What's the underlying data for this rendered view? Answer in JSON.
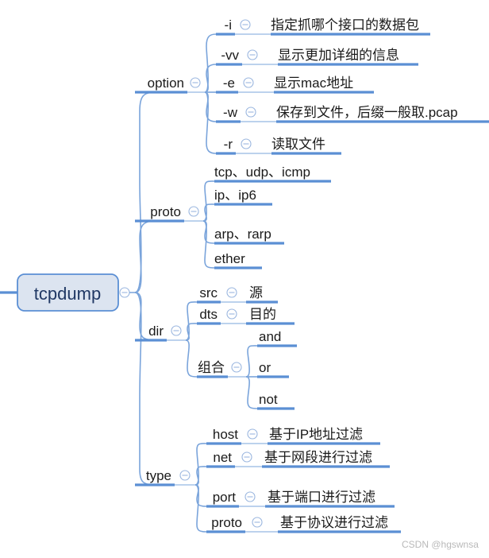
{
  "diagram": {
    "type": "mind-map",
    "title": "tcpdump",
    "root": {
      "label": "tcpdump",
      "toggle": "collapse-toggle-icon"
    },
    "watermark": "CSDN @hgswnsa",
    "colors": {
      "bar": "#5b8fd4",
      "branch": "#7aa4db",
      "root_fill": "#dce4f0",
      "root_border": "#5b8fd4",
      "root_text": "#203864",
      "node_text": "#1a1a1a",
      "toggle": "#9ab6df",
      "watermark": "#b9b9b9",
      "background": "#ffffff"
    },
    "branches": [
      {
        "label": "option",
        "children": [
          {
            "label": "-i",
            "desc": "指定抓哪个接口的数据包"
          },
          {
            "label": "-vv",
            "desc": "显示更加详细的信息"
          },
          {
            "label": "-e",
            "desc": "显示mac地址"
          },
          {
            "label": "-w",
            "desc": "保存到文件，后缀一般取.pcap"
          },
          {
            "label": "-r",
            "desc": "读取文件"
          }
        ]
      },
      {
        "label": "proto",
        "children": [
          {
            "label": "tcp、udp、icmp",
            "desc": ""
          },
          {
            "label": "ip、ip6",
            "desc": ""
          },
          {
            "label": "arp、rarp",
            "desc": ""
          },
          {
            "label": "ether",
            "desc": ""
          }
        ]
      },
      {
        "label": "dir",
        "children": [
          {
            "label": "src",
            "desc": "源"
          },
          {
            "label": "dts",
            "desc": "目的"
          },
          {
            "label": "组合",
            "desc": "",
            "children": [
              {
                "label": "and",
                "desc": ""
              },
              {
                "label": "or",
                "desc": ""
              },
              {
                "label": "not",
                "desc": ""
              }
            ]
          }
        ]
      },
      {
        "label": "type",
        "children": [
          {
            "label": "host",
            "desc": "基于IP地址过滤"
          },
          {
            "label": "net",
            "desc": "基于网段进行过滤"
          },
          {
            "label": "port",
            "desc": "基于端口进行过滤"
          },
          {
            "label": "proto",
            "desc": "基于协议进行过滤"
          }
        ]
      }
    ]
  }
}
